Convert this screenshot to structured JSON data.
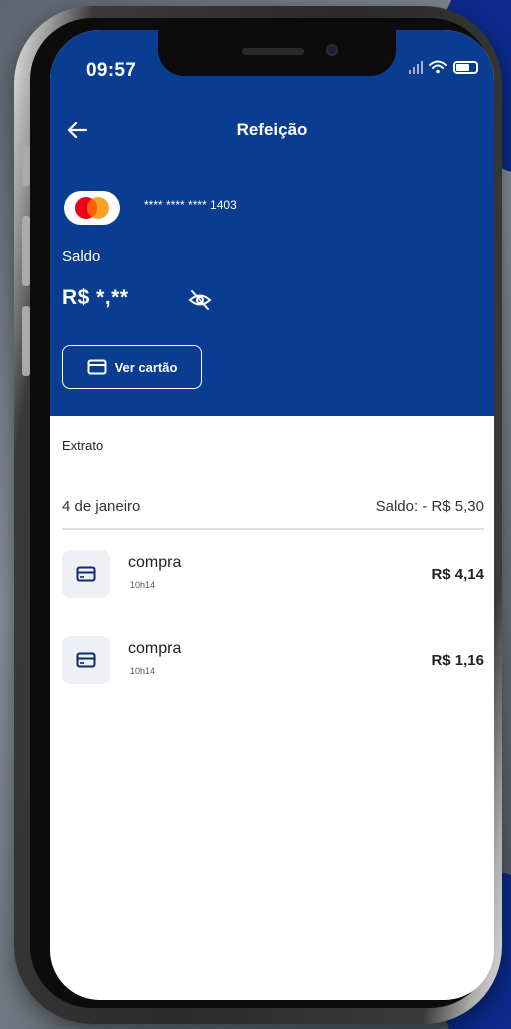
{
  "status_bar": {
    "time": "09:57"
  },
  "header": {
    "title": "Refeição"
  },
  "card": {
    "masked_number": "**** **** **** 1403"
  },
  "balance": {
    "label": "Saldo",
    "value": "R$ *,**"
  },
  "actions": {
    "view_card_label": "Ver cartão"
  },
  "statement": {
    "title": "Extrato",
    "groups": [
      {
        "date": "4 de janeiro",
        "balance": "Saldo: - R$ 5,30",
        "transactions": [
          {
            "name": "compra",
            "time": "10h14",
            "amount": "R$ 4,14"
          },
          {
            "name": "compra",
            "time": "10h14",
            "amount": "R$ 1,16"
          }
        ]
      }
    ]
  },
  "colors": {
    "header_bg": "#0a3d91",
    "mastercard_red": "#eb001b",
    "mastercard_orange": "#f79e1b"
  },
  "icons": [
    "back-arrow-icon",
    "mastercard-logo",
    "eye-off-icon",
    "card-icon",
    "wifi-icon",
    "battery-icon",
    "signal-icon"
  ]
}
